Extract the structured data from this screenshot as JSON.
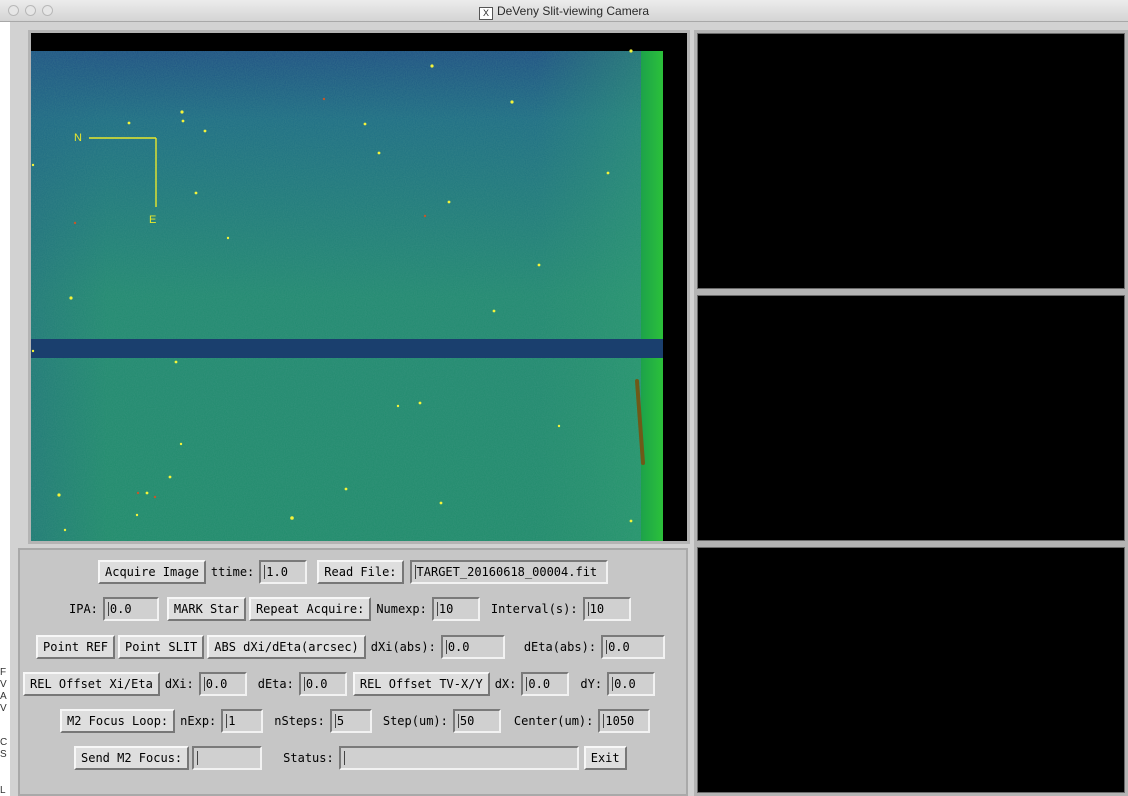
{
  "window": {
    "title": "DeVeny Slit-viewing Camera"
  },
  "left_strip": [
    "F",
    "V",
    "A",
    "V",
    "C",
    "S",
    "L"
  ],
  "overlay": {
    "north_label": "N",
    "east_label": "E"
  },
  "row1": {
    "acquire_label": "Acquire Image",
    "ttime_label": "ttime:",
    "ttime_value": "1.0",
    "read_file_label": "Read File:",
    "file_value": "TARGET_20160618_00004.fit"
  },
  "row2": {
    "ipa_label": "IPA:",
    "ipa_value": "0.0",
    "mark_star_label": "MARK Star",
    "repeat_acquire_label": "Repeat Acquire:",
    "numexp_label": "Numexp:",
    "numexp_value": "10",
    "interval_label": "Interval(s):",
    "interval_value": "10"
  },
  "row3": {
    "point_ref_label": "Point REF",
    "point_slit_label": "Point SLIT",
    "abs_label": "ABS dXi/dEta(arcsec)",
    "dxi_abs_label": "dXi(abs):",
    "dxi_abs_value": "0.0",
    "deta_abs_label": "dEta(abs):",
    "deta_abs_value": "0.0"
  },
  "row4": {
    "rel_xieta_label": "REL Offset Xi/Eta",
    "dxi_label": "dXi:",
    "dxi_value": "0.0",
    "deta_label": "dEta:",
    "deta_value": "0.0",
    "rel_tv_label": "REL Offset TV-X/Y",
    "dx_label": "dX:",
    "dx_value": "0.0",
    "dy_label": "dY:",
    "dy_value": "0.0"
  },
  "row5": {
    "m2_focus_loop_label": "M2 Focus Loop:",
    "nexp_label": "nExp:",
    "nexp_value": "1",
    "nsteps_label": "nSteps:",
    "nsteps_value": "5",
    "step_label": "Step(um):",
    "step_value": "50",
    "center_label": "Center(um):",
    "center_value": "1050"
  },
  "row6": {
    "send_m2_label": "Send M2 Focus:",
    "send_m2_value": "",
    "status_label": "Status:",
    "status_value": "",
    "exit_label": "Exit"
  },
  "colors": {
    "image_green": "#1f8a6e",
    "image_edge": "#22b33c",
    "overlay_yellow": "#e8e82c",
    "star_yellow": "#f4f43a"
  }
}
